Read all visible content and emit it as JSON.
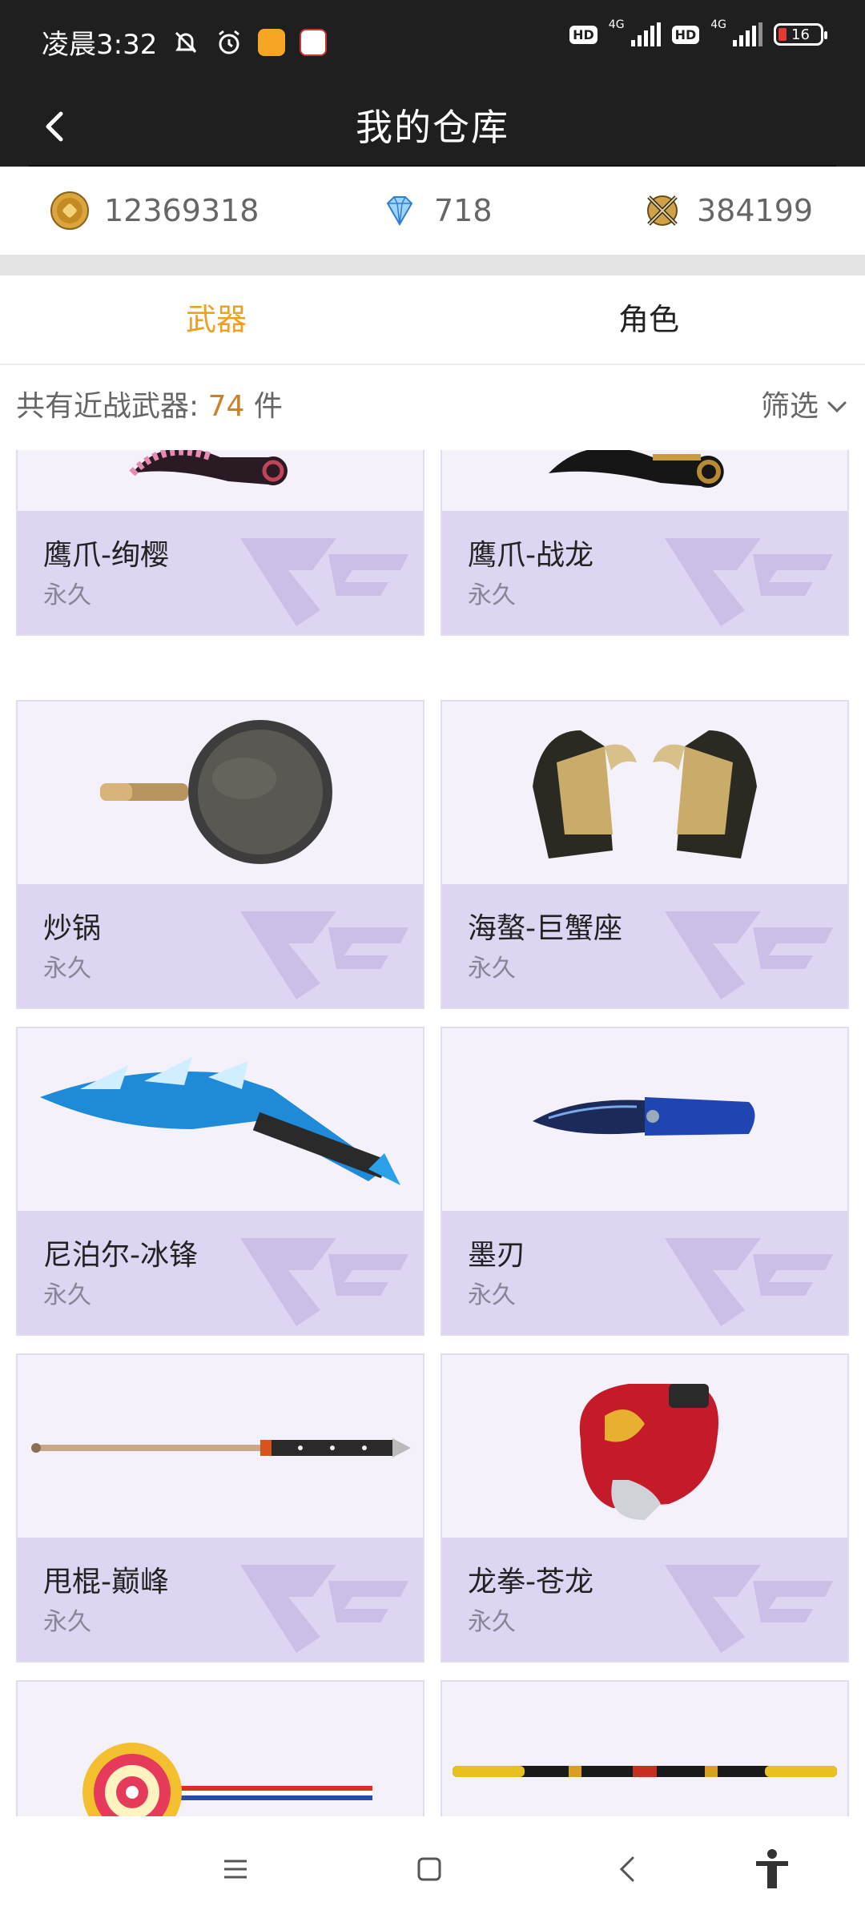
{
  "status_bar": {
    "time": "凌晨3:32",
    "network_1": "4G",
    "network_2": "4G",
    "hd_1": "HD",
    "hd_2": "HD",
    "battery": "16"
  },
  "header": {
    "title": "我的仓库"
  },
  "currency": {
    "gold": "12369318",
    "diamond": "718",
    "token": "384199"
  },
  "tabs": [
    {
      "label": "武器"
    },
    {
      "label": "角色"
    }
  ],
  "summary": {
    "prefix": "共有近战武器:",
    "count": "74",
    "suffix": "件",
    "filter_label": "筛选"
  },
  "items": [
    {
      "name": "鹰爪-绚樱",
      "duration": "永久",
      "icon": "karambit-pink-icon"
    },
    {
      "name": "鹰爪-战龙",
      "duration": "永久",
      "icon": "karambit-gold-icon"
    },
    {
      "name": "炒锅",
      "duration": "永久",
      "icon": "wok-icon"
    },
    {
      "name": "海螯-巨蟹座",
      "duration": "永久",
      "icon": "crab-claw-gauntlet-icon"
    },
    {
      "name": "尼泊尔-冰锋",
      "duration": "永久",
      "icon": "kukri-ice-icon"
    },
    {
      "name": "墨刃",
      "duration": "永久",
      "icon": "folding-knife-icon"
    },
    {
      "name": "甩棍-巅峰",
      "duration": "永久",
      "icon": "baton-icon"
    },
    {
      "name": "龙拳-苍龙",
      "duration": "永久",
      "icon": "boxing-glove-icon"
    },
    {
      "name": "",
      "duration": "",
      "icon": "lollipop-icon"
    },
    {
      "name": "",
      "duration": "",
      "icon": "golden-staff-icon"
    }
  ],
  "colors": {
    "header_bg": "#1f1f1f",
    "tab_active": "#f0a020",
    "count_accent": "#c9822b",
    "card_bg": "#f4f1fa",
    "card_info_bg": "#ddd5f1"
  }
}
